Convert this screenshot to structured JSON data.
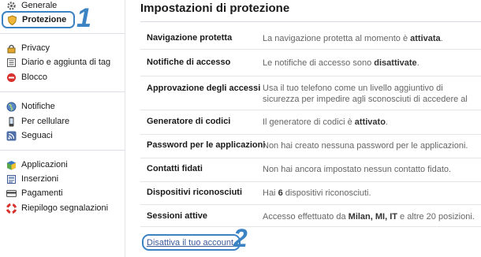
{
  "sidebar": {
    "items": [
      {
        "label": "Generale",
        "icon": "gear-icon"
      },
      {
        "label": "Protezione",
        "icon": "shield-badge-icon",
        "active": true
      },
      {
        "label": "Privacy",
        "icon": "lock-icon"
      },
      {
        "label": "Diario e aggiunta di tag",
        "icon": "timeline-icon"
      },
      {
        "label": "Blocco",
        "icon": "block-icon"
      },
      {
        "label": "Notifiche",
        "icon": "globe-icon"
      },
      {
        "label": "Per cellulare",
        "icon": "mobile-phone-icon"
      },
      {
        "label": "Seguaci",
        "icon": "rss-feed-icon"
      },
      {
        "label": "Applicazioni",
        "icon": "app-cube-icon"
      },
      {
        "label": "Inserzioni",
        "icon": "ads-icon"
      },
      {
        "label": "Pagamenti",
        "icon": "credit-card-icon"
      },
      {
        "label": "Riepilogo segnalazioni",
        "icon": "lifebuoy-icon"
      }
    ]
  },
  "annotations": {
    "one": "1",
    "two": "2"
  },
  "main": {
    "title": "Impostazioni di protezione",
    "settings": [
      {
        "name": "Navigazione protetta",
        "pre": "La navigazione protetta al momento è ",
        "strong": "attivata",
        "post": "."
      },
      {
        "name": "Notifiche di accesso",
        "pre": "Le notifiche di accesso sono ",
        "strong": "disattivate",
        "post": "."
      },
      {
        "name": "Approvazione degli accessi",
        "pre": "Usa il tuo telefono come un livello aggiuntivo di sicurezza per impedire agli sconosciuti di accedere al tuo account.",
        "strong": "",
        "post": ""
      },
      {
        "name": "Generatore di codici",
        "pre": "Il generatore di codici è ",
        "strong": "attivato",
        "post": "."
      },
      {
        "name": "Password per le applicazioni",
        "pre": "Non hai creato nessuna password per le applicazioni.",
        "strong": "",
        "post": ""
      },
      {
        "name": "Contatti fidati",
        "pre": "Non hai ancora impostato nessun contatto fidato.",
        "strong": "",
        "post": ""
      },
      {
        "name": "Dispositivi riconosciuti",
        "pre": "Hai ",
        "strong": "6",
        "post": " dispositivi riconosciuti."
      },
      {
        "name": "Sessioni attive",
        "pre": "Accesso effettuato da ",
        "strong": "Milan, MI, IT",
        "post": " e altre 20 posizioni."
      }
    ],
    "deactivate_link": "Disattiva il tuo account."
  },
  "colors": {
    "highlight": "#3c83c4",
    "link": "#3b5998"
  }
}
